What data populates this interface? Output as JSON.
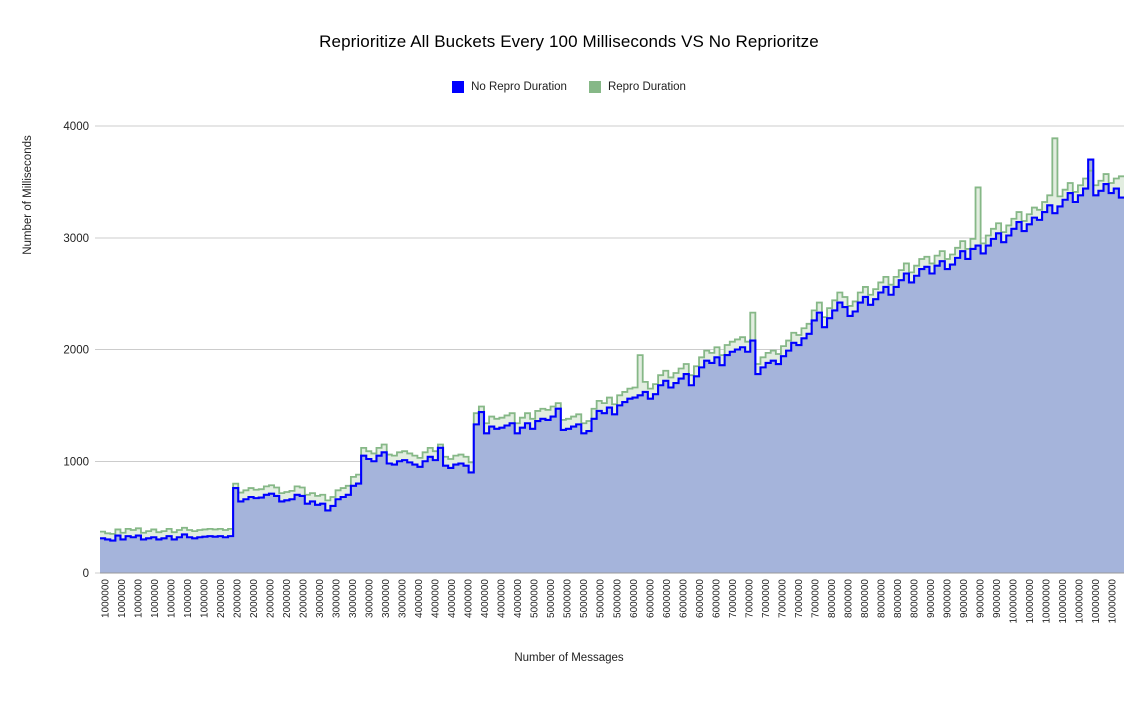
{
  "chart_data": {
    "type": "area",
    "title": "Reprioritize All Buckets Every 100 Milliseconds VS No Reprioritze",
    "xlabel": "Number of Messages",
    "ylabel": "Number of Milliseconds",
    "ylim": [
      0,
      4000
    ],
    "yticks": [
      0,
      1000,
      2000,
      3000,
      4000
    ],
    "ytick_labels": [
      "0",
      "1000",
      "2000",
      "3000",
      "4000"
    ],
    "grid": true,
    "grid_axis": "y",
    "legend_position": "top-center",
    "interpolation": "step",
    "legend": [
      "No Repro Duration",
      "Repro Duration"
    ],
    "colors": {
      "no_repro_line": "#0000ff",
      "no_repro_fill": "#a5b4db",
      "repro_line": "#86b887",
      "repro_fill": "#e2ede0",
      "grid": "#cccccc",
      "axis": "#999999",
      "text": "#222222",
      "background": "#ffffff"
    },
    "xtick_labels": [
      "1000000",
      "1000000",
      "1000000",
      "1000000",
      "1000000",
      "1000000",
      "1000000",
      "2000000",
      "2000000",
      "2000000",
      "2000000",
      "2000000",
      "2000000",
      "3000000",
      "3000000",
      "3000000",
      "3000000",
      "3000000",
      "3000000",
      "4000000",
      "4000000",
      "4000000",
      "4000000",
      "4000000",
      "4000000",
      "4000000",
      "5000000",
      "5000000",
      "5000000",
      "5000000",
      "5000000",
      "5000000",
      "6000000",
      "6000000",
      "6000000",
      "6000000",
      "6000000",
      "6000000",
      "7000000",
      "7000000",
      "7000000",
      "7000000",
      "7000000",
      "7000000",
      "8000000",
      "8000000",
      "8000000",
      "8000000",
      "8000000",
      "8000000",
      "9000000",
      "9000000",
      "9000000",
      "9000000",
      "9000000",
      "10000000",
      "10000000",
      "10000000",
      "10000000",
      "10000000",
      "10000000",
      "10000000"
    ],
    "categories": [
      "1000000",
      "1000000",
      "1000000",
      "1000000",
      "1000000",
      "1000000",
      "1000000",
      "2000000",
      "2000000",
      "2000000",
      "2000000",
      "2000000",
      "2000000",
      "3000000",
      "3000000",
      "3000000",
      "3000000",
      "3000000",
      "3000000",
      "4000000",
      "4000000",
      "4000000",
      "4000000",
      "4000000",
      "4000000",
      "4000000",
      "5000000",
      "5000000",
      "5000000",
      "5000000",
      "5000000",
      "5000000",
      "6000000",
      "6000000",
      "6000000",
      "6000000",
      "6000000",
      "6000000",
      "7000000",
      "7000000",
      "7000000",
      "7000000",
      "7000000",
      "7000000",
      "8000000",
      "8000000",
      "8000000",
      "8000000",
      "8000000",
      "8000000",
      "9000000",
      "9000000",
      "9000000",
      "9000000",
      "9000000",
      "10000000",
      "10000000",
      "10000000",
      "10000000",
      "10000000",
      "10000000",
      "10000000"
    ],
    "series": [
      {
        "name": "No Repro Duration",
        "color": "#0000ff",
        "fill": "#a5b4db",
        "values": [
          310,
          300,
          290,
          335,
          300,
          330,
          320,
          335,
          300,
          310,
          320,
          300,
          310,
          330,
          300,
          320,
          345,
          320,
          310,
          320,
          325,
          330,
          325,
          330,
          320,
          330,
          760,
          640,
          660,
          680,
          670,
          675,
          700,
          710,
          690,
          640,
          650,
          660,
          700,
          690,
          620,
          640,
          610,
          620,
          560,
          600,
          660,
          680,
          700,
          780,
          800,
          1050,
          1020,
          1000,
          1050,
          1080,
          980,
          970,
          1000,
          1010,
          990,
          970,
          950,
          1000,
          1040,
          1010,
          1120,
          960,
          940,
          970,
          980,
          960,
          900,
          1330,
          1440,
          1250,
          1310,
          1290,
          1300,
          1320,
          1340,
          1250,
          1300,
          1340,
          1290,
          1360,
          1380,
          1370,
          1400,
          1470,
          1280,
          1290,
          1310,
          1330,
          1250,
          1270,
          1380,
          1450,
          1430,
          1480,
          1420,
          1500,
          1530,
          1560,
          1570,
          1590,
          1620,
          1560,
          1600,
          1680,
          1720,
          1660,
          1700,
          1740,
          1780,
          1680,
          1760,
          1840,
          1900,
          1880,
          1930,
          1860,
          1950,
          1980,
          2000,
          2020,
          1980,
          2080,
          1780,
          1840,
          1880,
          1900,
          1870,
          1940,
          1990,
          2060,
          2040,
          2100,
          2140,
          2260,
          2330,
          2200,
          2280,
          2350,
          2420,
          2380,
          2300,
          2340,
          2420,
          2470,
          2400,
          2450,
          2510,
          2560,
          2490,
          2560,
          2620,
          2680,
          2600,
          2660,
          2720,
          2740,
          2680,
          2750,
          2790,
          2720,
          2760,
          2820,
          2880,
          2810,
          2900,
          2930,
          2860,
          2930,
          2990,
          3040,
          2960,
          3020,
          3080,
          3140,
          3060,
          3120,
          3180,
          3160,
          3230,
          3290,
          3220,
          3280,
          3340,
          3400,
          3320,
          3380,
          3440,
          3700,
          3380,
          3420,
          3480,
          3400,
          3440,
          3360
        ]
      },
      {
        "name": "Repro Duration",
        "color": "#86b887",
        "fill": "#e2ede0",
        "values": [
          370,
          355,
          350,
          390,
          360,
          395,
          385,
          400,
          360,
          375,
          390,
          365,
          375,
          395,
          365,
          385,
          405,
          385,
          375,
          385,
          390,
          395,
          390,
          395,
          385,
          395,
          800,
          720,
          740,
          760,
          745,
          750,
          775,
          785,
          765,
          715,
          725,
          735,
          775,
          765,
          700,
          715,
          690,
          700,
          650,
          680,
          740,
          760,
          780,
          860,
          880,
          1120,
          1090,
          1070,
          1120,
          1150,
          1060,
          1050,
          1080,
          1090,
          1070,
          1050,
          1030,
          1080,
          1120,
          1090,
          1150,
          1040,
          1020,
          1050,
          1060,
          1040,
          990,
          1430,
          1490,
          1340,
          1400,
          1380,
          1390,
          1410,
          1430,
          1340,
          1390,
          1430,
          1380,
          1450,
          1470,
          1460,
          1490,
          1520,
          1370,
          1380,
          1400,
          1420,
          1340,
          1360,
          1470,
          1540,
          1520,
          1570,
          1510,
          1590,
          1620,
          1650,
          1660,
          1950,
          1710,
          1650,
          1690,
          1770,
          1810,
          1750,
          1790,
          1830,
          1870,
          1770,
          1850,
          1930,
          1990,
          1970,
          2020,
          1950,
          2040,
          2070,
          2090,
          2110,
          2070,
          2330,
          1870,
          1930,
          1970,
          1990,
          1960,
          2030,
          2080,
          2150,
          2130,
          2190,
          2230,
          2350,
          2420,
          2290,
          2370,
          2440,
          2510,
          2470,
          2390,
          2430,
          2510,
          2560,
          2490,
          2540,
          2600,
          2650,
          2580,
          2650,
          2710,
          2770,
          2690,
          2750,
          2810,
          2830,
          2770,
          2840,
          2880,
          2810,
          2850,
          2910,
          2970,
          2900,
          2990,
          3450,
          2950,
          3020,
          3080,
          3130,
          3050,
          3110,
          3170,
          3230,
          3150,
          3210,
          3270,
          3250,
          3320,
          3380,
          3890,
          3370,
          3430,
          3490,
          3410,
          3470,
          3530,
          3600,
          3470,
          3510,
          3570,
          3490,
          3530,
          3550
        ]
      }
    ]
  }
}
